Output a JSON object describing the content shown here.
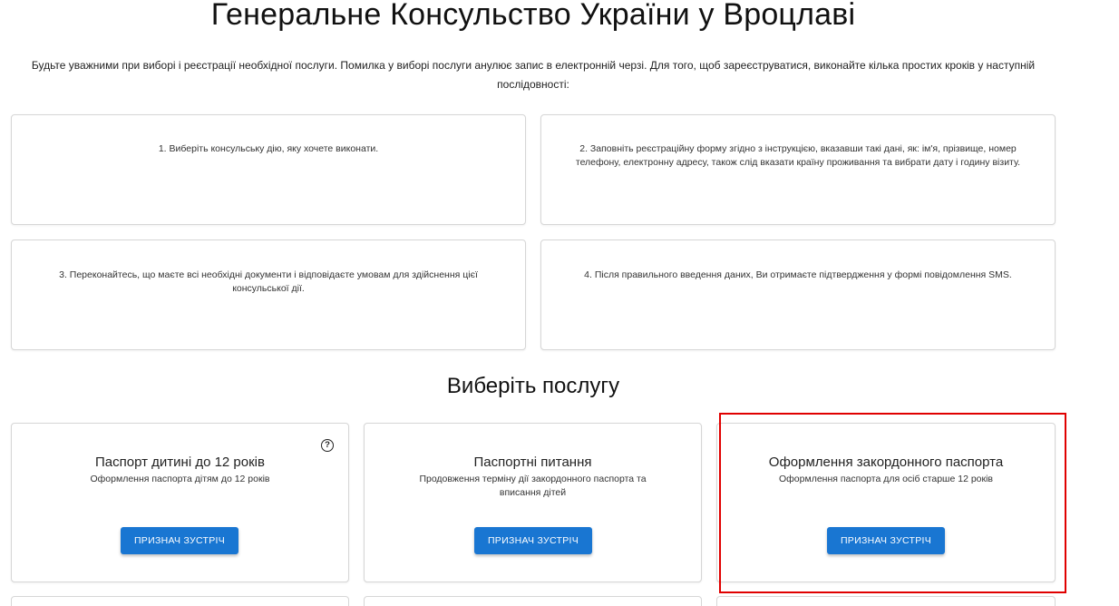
{
  "page": {
    "title": "Генеральне Консульство України у Вроцлаві",
    "intro": "Будьте уважними при виборі і реєстрації необхідної послуги. Помилка у виборі послуги анулює запис в електронній черзі. Для того, щоб зареєструватися, виконайте кілька простих кроків у наступній послідовності:"
  },
  "steps": [
    {
      "text": "1. Виберіть консульську дію, яку хочете виконати."
    },
    {
      "text": "2. Заповніть реєстраційну форму згідно з інструкцією, вказавши такі дані, як: ім'я, прізвище, номер телефону, електронну адресу, також слід вказати країну проживання та вибрати дату і годину візиту."
    },
    {
      "text": "3. Переконайтесь, що маєте всі необхідні документи і відповідаєте умовам для здійснення цієї консульської дії."
    },
    {
      "text": "4. Після правильного введення даних, Ви отримаєте підтвердження у формі повідомлення SMS."
    }
  ],
  "services": {
    "heading": "Виберіть послугу",
    "items": [
      {
        "title": "Паспорт дитині до 12 років",
        "subtitle": "Оформлення паспорта дітям до 12 років",
        "button": "ПРИЗНАЧ ЗУСТРІЧ",
        "help_icon": "?",
        "icon": "help-circle-icon"
      },
      {
        "title": "Паспортні питання",
        "subtitle": "Продовження терміну дії закордонного паспорта та вписання дітей",
        "button": "ПРИЗНАЧ ЗУСТРІЧ"
      },
      {
        "title": "Оформлення закордонного паспорта",
        "subtitle": "Оформлення паспорта для осіб старше 12 років",
        "button": "ПРИЗНАЧ ЗУСТРІЧ",
        "highlighted": true
      }
    ]
  },
  "colors": {
    "accent": "#1976d2",
    "highlight": "#e00000"
  }
}
